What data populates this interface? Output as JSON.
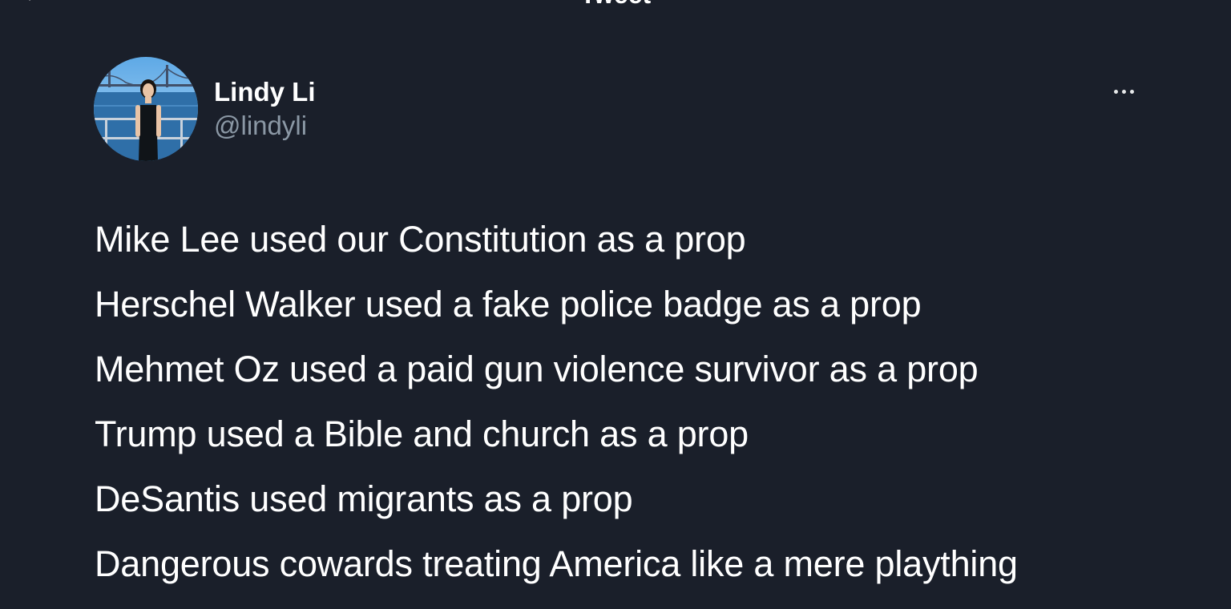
{
  "header": {
    "title": "Tweet",
    "back_icon": "arrow-left-icon"
  },
  "tweet": {
    "author": {
      "display_name": "Lindy Li",
      "handle": "@lindyli",
      "avatar_icon": "profile-photo"
    },
    "more_icon": "ellipsis-icon",
    "lines": [
      "Mike Lee used our Constitution as a prop",
      "Herschel Walker used a fake police badge as a prop",
      "Mehmet Oz used a paid gun violence survivor as a prop",
      "Trump used a Bible and church as a prop",
      "DeSantis used migrants as a prop",
      "Dangerous cowards treating America like a mere plaything"
    ]
  },
  "colors": {
    "background": "#1a1f2a",
    "text_primary": "#ffffff",
    "text_secondary": "#8b98a5"
  }
}
